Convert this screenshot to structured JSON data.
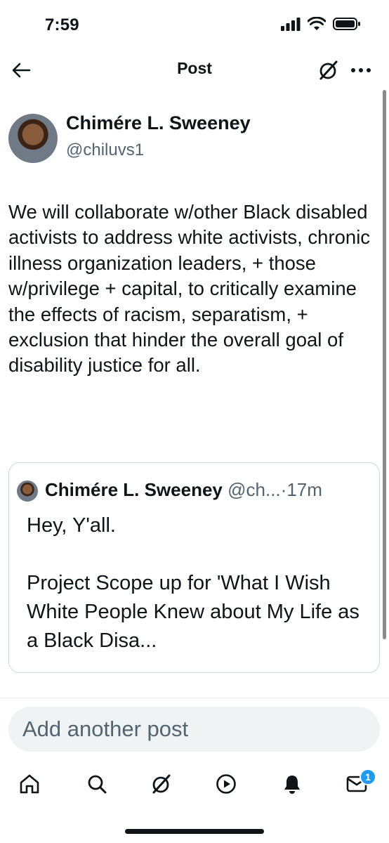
{
  "status_bar": {
    "time": "7:59"
  },
  "header": {
    "title": "Post"
  },
  "post": {
    "author_name": "Chimére L. Sweeney",
    "author_handle": "@chiluvs1",
    "text": "We will collaborate w/other Black disabled activists to address white activists, chronic illness organization leaders, + those w/privilege + capital, to critically examine the effects of racism, separatism, + exclusion that hinder the overall goal of disability justice for all."
  },
  "quote": {
    "author_name": "Chimére L. Sweeney",
    "author_handle": "@ch...",
    "separator": "·",
    "time": "17m",
    "text": "Hey, Y'all.\n\nProject Scope up for 'What I Wish White People Knew about My Life as a Black Disa..."
  },
  "compose": {
    "placeholder": "Add another post"
  },
  "nav": {
    "messages_badge": "1"
  },
  "colors": {
    "text_primary": "#0f1419",
    "text_secondary": "#536471",
    "accent": "#1d9bf0",
    "border": "#cfd9de",
    "input_bg": "#eff3f4"
  }
}
